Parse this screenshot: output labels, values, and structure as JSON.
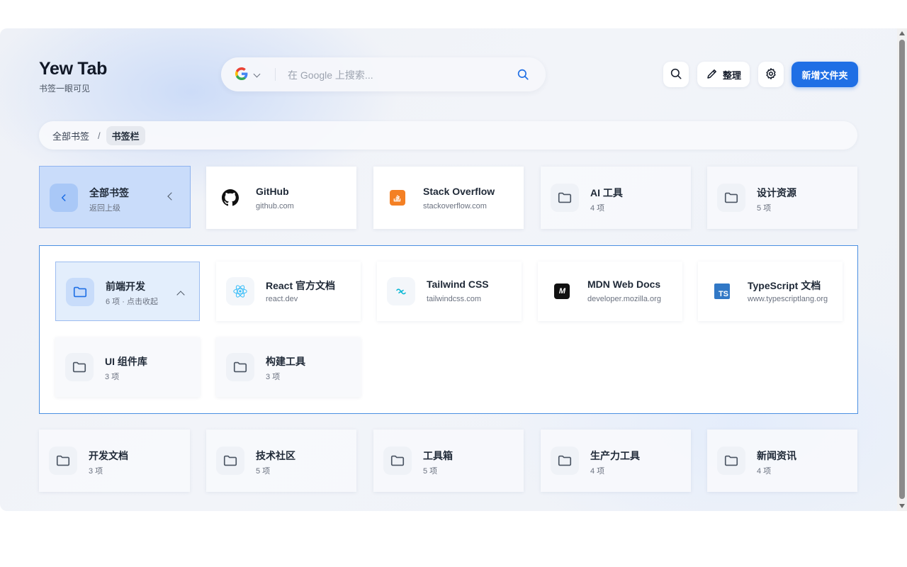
{
  "brand": {
    "title": "Yew Tab",
    "subtitle": "书签一眼可见"
  },
  "search": {
    "engine": "Google",
    "placeholder": "在 Google 上搜索..."
  },
  "toolbar": {
    "organize_label": "整理",
    "new_folder_label": "新增文件夹"
  },
  "breadcrumb": {
    "root": "全部书签",
    "separator": "/",
    "current": "书签栏"
  },
  "row1": [
    {
      "name": "全部书签",
      "meta": "返回上级",
      "kind": "back",
      "icon": "chevron-left-icon"
    },
    {
      "name": "GitHub",
      "meta": "github.com",
      "kind": "site",
      "icon": "github-icon"
    },
    {
      "name": "Stack Overflow",
      "meta": "stackoverflow.com",
      "kind": "site",
      "icon": "stackoverflow-icon"
    },
    {
      "name": "AI 工具",
      "meta": "4 项",
      "kind": "folder",
      "icon": "folder-icon"
    },
    {
      "name": "设计资源",
      "meta": "5 项",
      "kind": "folder",
      "icon": "folder-icon"
    }
  ],
  "expanded": {
    "header": {
      "name": "前端开发",
      "meta": "6 项 · 点击收起",
      "icon": "folder-icon"
    },
    "items": [
      {
        "name": "React 官方文档",
        "meta": "react.dev",
        "icon": "react-icon"
      },
      {
        "name": "Tailwind CSS",
        "meta": "tailwindcss.com",
        "icon": "tailwind-icon"
      },
      {
        "name": "MDN Web Docs",
        "meta": "developer.mozilla.org",
        "icon": "mdn-icon",
        "badge": "M"
      },
      {
        "name": "TypeScript 文档",
        "meta": "www.typescriptlang.org",
        "icon": "typescript-icon",
        "badge": "TS"
      },
      {
        "name": "UI 组件库",
        "meta": "3 项",
        "icon": "folder-icon"
      },
      {
        "name": "构建工具",
        "meta": "3 项",
        "icon": "folder-icon"
      }
    ]
  },
  "row3": [
    {
      "name": "开发文档",
      "meta": "3 项"
    },
    {
      "name": "技术社区",
      "meta": "5 项"
    },
    {
      "name": "工具箱",
      "meta": "5 项"
    },
    {
      "name": "生产力工具",
      "meta": "4 项"
    },
    {
      "name": "新闻资讯",
      "meta": "4 项"
    }
  ],
  "colors": {
    "accent": "#1f6fe5",
    "active_card": "#c9dcfa",
    "panel_border": "#4b90e2"
  }
}
